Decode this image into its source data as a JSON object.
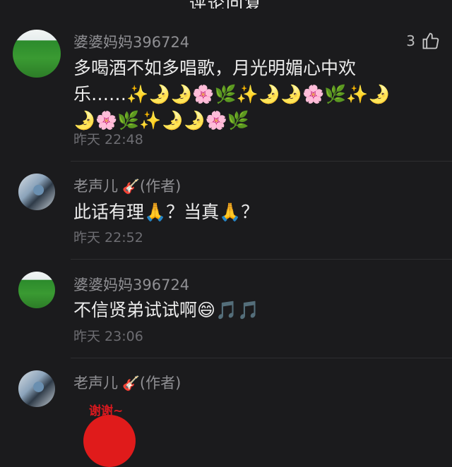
{
  "header": {
    "title": "评论回复"
  },
  "comments": [
    {
      "username": "婆婆妈妈396724",
      "text": "多喝酒不如多唱歌，月光明媚心中欢乐……✨🌛🌛🌸🌿✨🌛🌛🌸🌿✨🌛🌛🌸🌿✨🌛🌛🌸🌿",
      "time": "昨天 22:48",
      "likes": "3"
    },
    {
      "username": "老声儿",
      "badge": "🎸",
      "author_tag": "(作者)",
      "text": "此话有理🙏？当真🙏？",
      "time": "昨天 22:52"
    },
    {
      "username": "婆婆妈妈396724",
      "text": "不信贤弟试试啊😄🎵🎵",
      "time": "昨天 23:06"
    },
    {
      "username": "老声儿",
      "badge": "🎸",
      "author_tag": "(作者)",
      "sticker_text": "谢谢~"
    }
  ]
}
